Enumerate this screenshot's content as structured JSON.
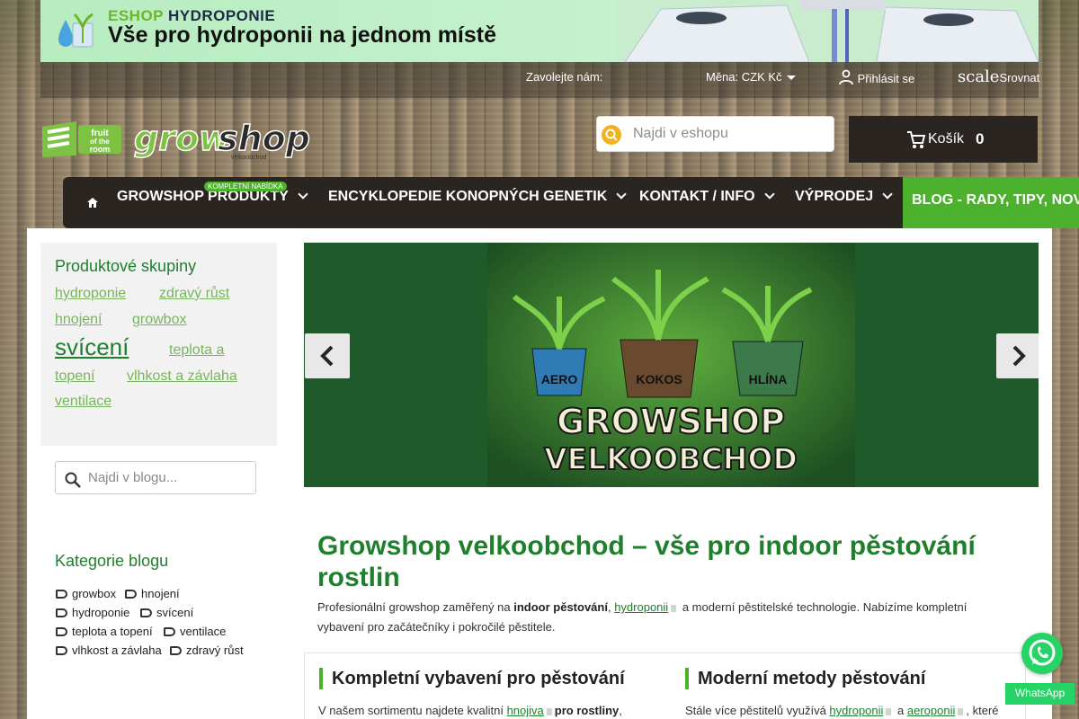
{
  "banner": {
    "tag_eshop": "ESHOP",
    "tag_hydro": "HYDROPONIE",
    "headline": "Vše pro hydroponii na jednom místě"
  },
  "utility": {
    "call_label": "Zavolejte nám:",
    "currency_label": "Měna:",
    "currency_value": "CZK Kč",
    "login_label": "Přihlásit se",
    "compare_icon_text": "scale",
    "compare_label": "Srovnat"
  },
  "header": {
    "search_placeholder": "Najdi v eshopu",
    "cart_label": "Košík",
    "cart_count": "0"
  },
  "nav": {
    "items": [
      {
        "label": "GROWSHOP PRODUKTY",
        "badge": "KOMPLETNÍ NABÍDKA"
      },
      {
        "label": "ENCYKLOPEDIE KONOPNÝCH GENETIK"
      },
      {
        "label": "KONTAKT / INFO"
      },
      {
        "label": "VÝPRODEJ"
      }
    ],
    "blog_label": "BLOG - RADY, TIPY, NOVI"
  },
  "sidebar": {
    "groups_title": "Produktové skupiny",
    "tags": [
      "hydroponie",
      "zdravý růst",
      "hnojení",
      "growbox",
      "svícení",
      "teplota a",
      "topení",
      "vlhkost a závlaha",
      "ventilace"
    ],
    "blog_search_placeholder": "Najdi v blogu...",
    "categories_title": "Kategorie blogu",
    "categories": [
      "growbox",
      "hnojení",
      "hydroponie",
      "svícení",
      "teplota a topení",
      "ventilace",
      "vlhkost a závlaha",
      "zdravý růst"
    ]
  },
  "slider": {
    "pot_labels": [
      "AERO",
      "KOKOS",
      "HLÍNA"
    ],
    "title_line1": "GROWSHOP",
    "title_line2": "VELKOOBCHOD"
  },
  "content": {
    "title": "Growshop velkoobchod – vše pro indoor pěstování rostlin",
    "intro_prefix": "Profesionální growshop zaměřený na ",
    "intro_bold": "indoor pěstování",
    "intro_link": "hydroponii",
    "intro_suffix": " a moderní pěstitelské technologie. Nabízíme kompletní",
    "intro_line2": "vybavení pro začátečníky i pokročilé pěstitele.",
    "col1_heading": "Kompletní vybavení pro pěstování",
    "col1_prefix": "V našem sortimentu najdete kvalitní ",
    "col1_link": "hnojiva",
    "col1_bold": "pro rostliny",
    "col2_heading": "Moderní metody pěstování",
    "col2_prefix": "Stále více pěstitelů využívá ",
    "col2_link1": "hydroponii",
    "col2_mid": " a ",
    "col2_link2": "aeroponii",
    "col2_suffix": ", které"
  },
  "whatsapp": {
    "label": "WhatsApp"
  },
  "colors": {
    "brand_green": "#4cb12c",
    "title_green": "#1e7f2c",
    "nav_dark": "#2b2522",
    "whatsapp": "#25d366"
  }
}
